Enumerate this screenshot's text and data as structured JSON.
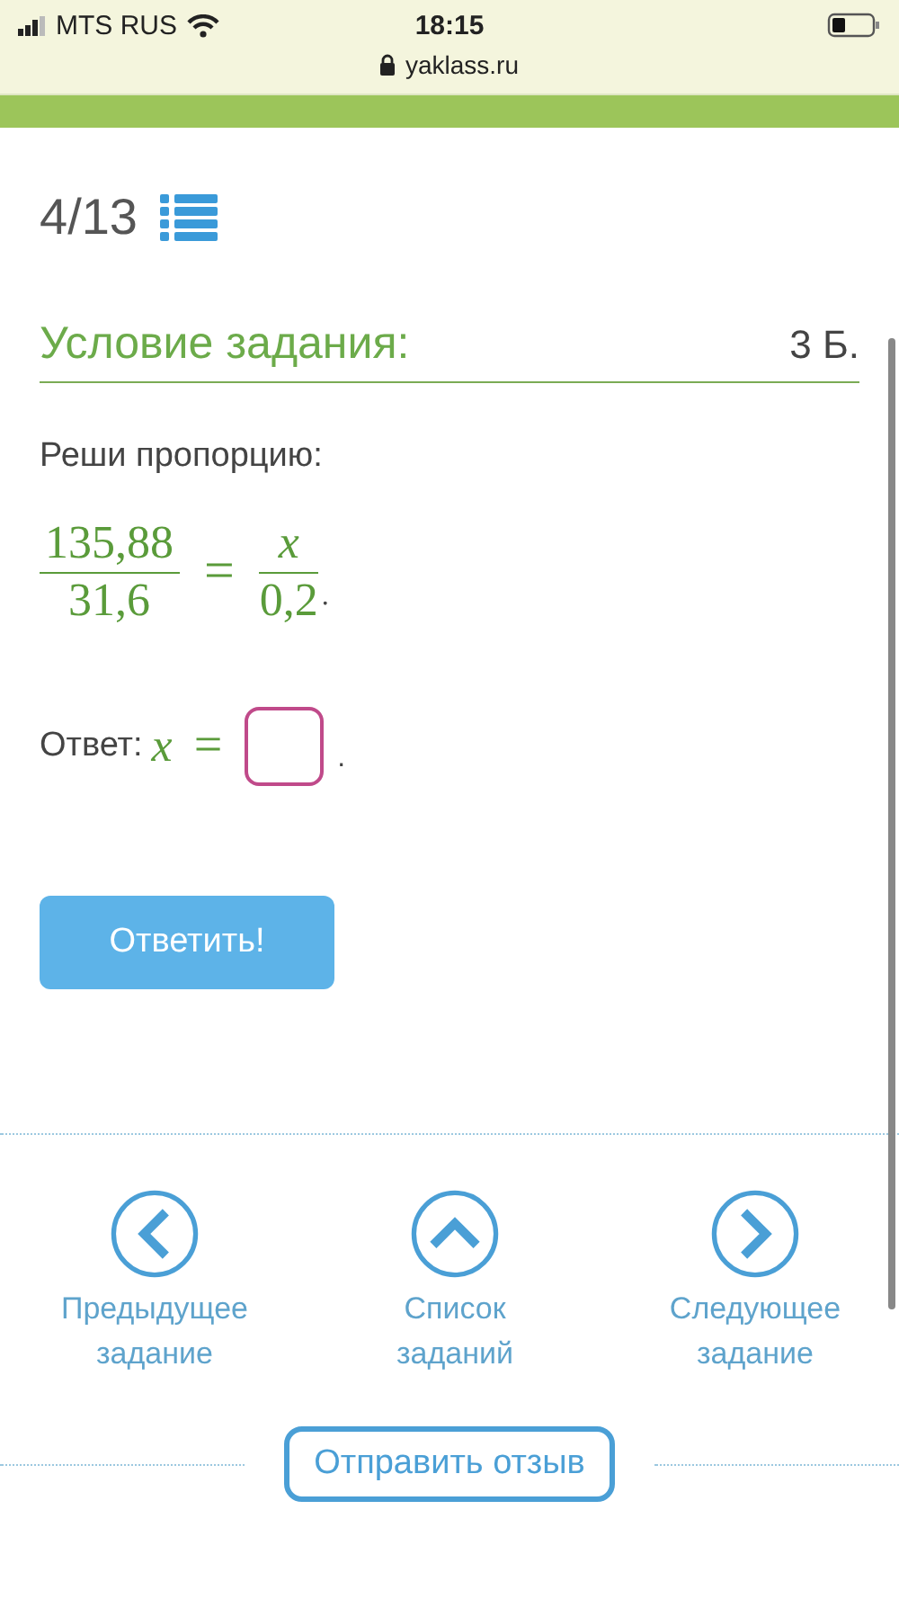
{
  "status_bar": {
    "carrier": "MTS RUS",
    "time": "18:15",
    "url": "yaklass.ru"
  },
  "progress": "4/13",
  "task": {
    "heading": "Условие задания:",
    "points": "3 Б.",
    "prompt": "Реши пропорцию:",
    "equation": {
      "left_num": "135,88",
      "left_den": "31,6",
      "equals": "=",
      "right_num": "x",
      "right_den": "0,2",
      "end": "."
    },
    "answer": {
      "label": "Ответ:",
      "variable": "x",
      "equals": "=",
      "end": "."
    }
  },
  "submit_button": "Ответить!",
  "nav": [
    {
      "kind": "prev",
      "label": "Предыдущее задание"
    },
    {
      "kind": "list",
      "label": "Список заданий"
    },
    {
      "kind": "next",
      "label": "Следующее задание"
    }
  ],
  "feedback_button": "Отправить отзыв"
}
